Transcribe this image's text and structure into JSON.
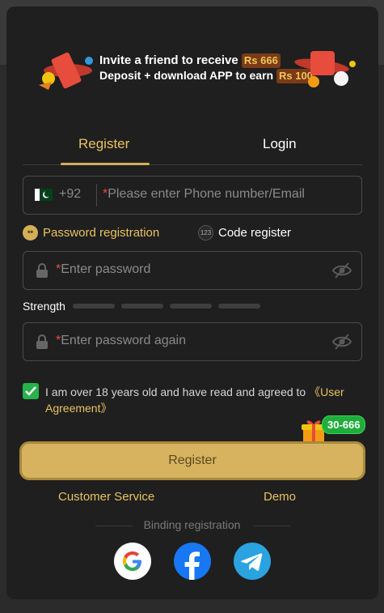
{
  "banner": {
    "line1_text": "Invite a friend to receive",
    "line1_amount": "Rs 666",
    "line2_text": "Deposit + download APP to earn",
    "line2_amount": "Rs 100"
  },
  "tabs": {
    "register": "Register",
    "login": "Login"
  },
  "phone": {
    "country_code": "+92",
    "required_mark": "*",
    "placeholder": "Please enter Phone number/Email"
  },
  "reg_options": {
    "password": "Password registration",
    "password_icon": "**",
    "code": "Code register",
    "code_icon": "123"
  },
  "password": {
    "required_mark": "*",
    "placeholder": "Enter password"
  },
  "strength": {
    "label": "Strength",
    "level": 0,
    "segments": 4
  },
  "password_again": {
    "required_mark": "*",
    "placeholder": "Enter password again"
  },
  "agreement": {
    "checked": true,
    "text": "I am over 18 years old and have read and agreed to ",
    "link": "《User Agreement》"
  },
  "promo_badge": "30-666",
  "register_button": "Register",
  "customer_service": "Customer Service",
  "demo": "Demo",
  "binding_label": "Binding registration",
  "social": [
    "google-icon",
    "facebook-icon",
    "telegram-icon"
  ],
  "colors": {
    "accent": "#e7c35f",
    "button": "#d7b35f",
    "check": "#27b24a",
    "badge": "#1fae3c"
  }
}
